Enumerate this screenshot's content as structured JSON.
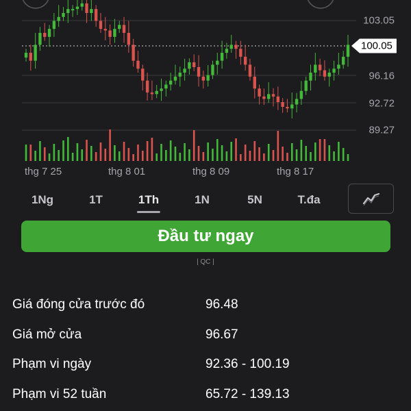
{
  "chart": {
    "price_levels": [
      "103.05",
      "96.16",
      "92.72",
      "89.27"
    ],
    "current_price": "100.05",
    "date_labels": [
      "thg 7 25",
      "thg 8 01",
      "thg 8 09",
      "thg 8 17"
    ],
    "colors": {
      "up": "#43b83a",
      "down": "#d9534f",
      "grid": "#3a3a3c",
      "dashed": "#d0d0d0"
    },
    "y_range": [
      87.5,
      107.5
    ]
  },
  "range_tabs": [
    {
      "label": "1Ng",
      "active": false
    },
    {
      "label": "1T",
      "active": false
    },
    {
      "label": "1Th",
      "active": true
    },
    {
      "label": "1N",
      "active": false
    },
    {
      "label": "5N",
      "active": false
    },
    {
      "label": "T.đa",
      "active": false
    }
  ],
  "chart_type_icon": "line-chart-icon",
  "invest_button": {
    "label": "Đầu tư ngay",
    "color": "#3fa636"
  },
  "ad_label": "| QC |",
  "stats": [
    {
      "label": "Giá đóng cửa trước đó",
      "value": "96.48"
    },
    {
      "label": "Giá mở cửa",
      "value": "96.67"
    },
    {
      "label": "Phạm vi ngày",
      "value": "92.36 - 100.19"
    },
    {
      "label": "Phạm vi 52 tuần",
      "value": "65.72 - 139.13"
    }
  ]
}
